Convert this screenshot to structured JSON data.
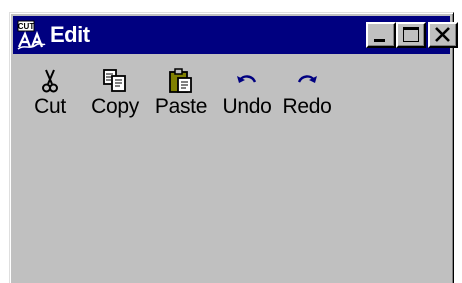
{
  "window": {
    "title": "Edit",
    "app_icon": "cut-paste-app-icon",
    "app_icon_caption": "CUT",
    "controls": {
      "minimize_icon": "minimize-icon",
      "maximize_icon": "maximize-icon",
      "close_icon": "close-icon"
    }
  },
  "toolbar": {
    "items": [
      {
        "label": "Cut",
        "icon": "scissors-icon"
      },
      {
        "label": "Copy",
        "icon": "copy-icon"
      },
      {
        "label": "Paste",
        "icon": "clipboard-icon"
      },
      {
        "label": "Undo",
        "icon": "undo-icon"
      },
      {
        "label": "Redo",
        "icon": "redo-icon"
      }
    ]
  },
  "colors": {
    "titlebar": "#000080",
    "face": "#c0c0c0",
    "undo_redo_icon": "#000080"
  }
}
